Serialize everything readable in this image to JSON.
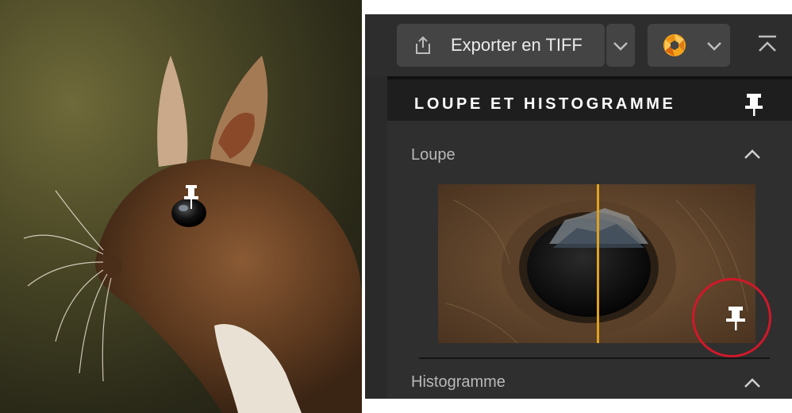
{
  "toolbar": {
    "export_label": "Exporter en TIFF",
    "export_icon": "share-export-icon",
    "export_dropdown_icon": "chevron-down-icon",
    "app_icon": "dxo-aperture-icon",
    "app_dropdown_icon": "chevron-down-icon",
    "collapse_icon": "collapse-up-icon"
  },
  "panel": {
    "title": "LOUPE ET HISTOGRAMME",
    "title_pin_icon": "pin-icon"
  },
  "loupe": {
    "label": "Loupe",
    "chevron_icon": "chevron-up-icon",
    "pin_icon": "pin-icon",
    "split_line_color": "#e0a21f"
  },
  "histogram": {
    "label": "Histogramme",
    "chevron_icon": "chevron-up-icon"
  },
  "photo": {
    "pin_cursor_icon": "pin-icon"
  },
  "annotation": {
    "circle_color": "#d0182a"
  }
}
